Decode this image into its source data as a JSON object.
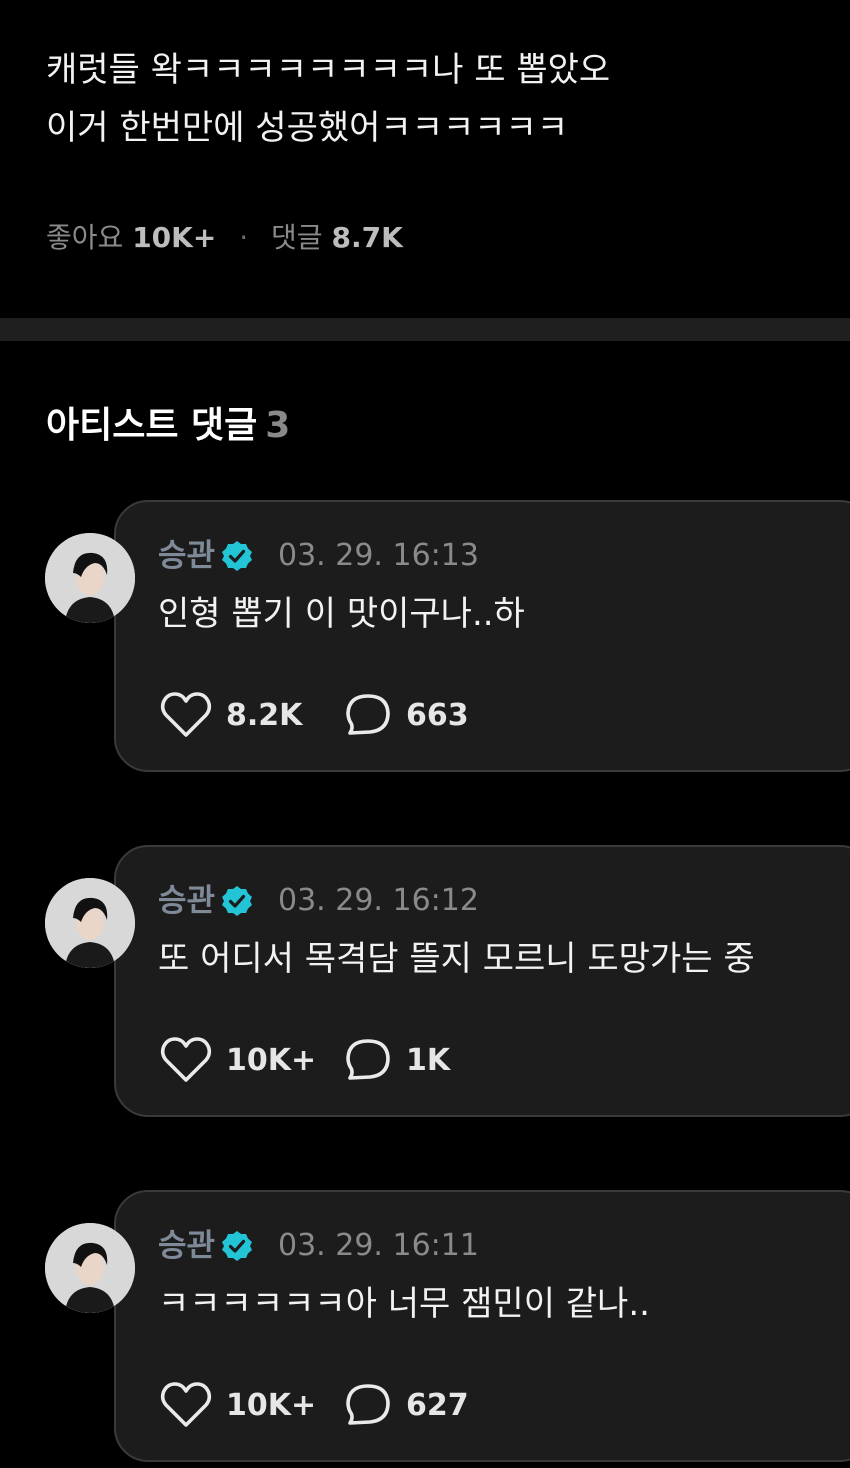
{
  "post": {
    "line1": "캐럿들 왁ㅋㅋㅋㅋㅋㅋㅋㅋ나 또 뽑았오",
    "line2": "이거 한번만에 성공했어ㅋㅋㅋㅋㅋㅋ",
    "likes_label": "좋아요",
    "likes_count": "10K+",
    "comments_label": "댓글",
    "comments_count": "8.7K"
  },
  "artist_comments": {
    "title": "아티스트 댓글",
    "count": "3",
    "items": [
      {
        "author": "승관",
        "timestamp": "03. 29. 16:13",
        "text": "인형 뽑기 이 맛이구나..하",
        "likes": "8.2K",
        "replies": "663"
      },
      {
        "author": "승관",
        "timestamp": "03. 29. 16:12",
        "text": "또 어디서 목격담 뜰지 모르니 도망가는 중",
        "likes": "10K+",
        "replies": "1K"
      },
      {
        "author": "승관",
        "timestamp": "03. 29. 16:11",
        "text": "ㅋㅋㅋㅋㅋㅋ아 너무 잼민이 같나..",
        "likes": "10K+",
        "replies": "627"
      }
    ]
  },
  "icons": {
    "verified": "verified-badge-icon",
    "like": "heart-icon",
    "reply": "speech-bubble-icon"
  },
  "colors": {
    "background": "#000000",
    "card": "#1c1c1c",
    "verified": "#22c4d6",
    "muted": "#8a8a8a"
  }
}
